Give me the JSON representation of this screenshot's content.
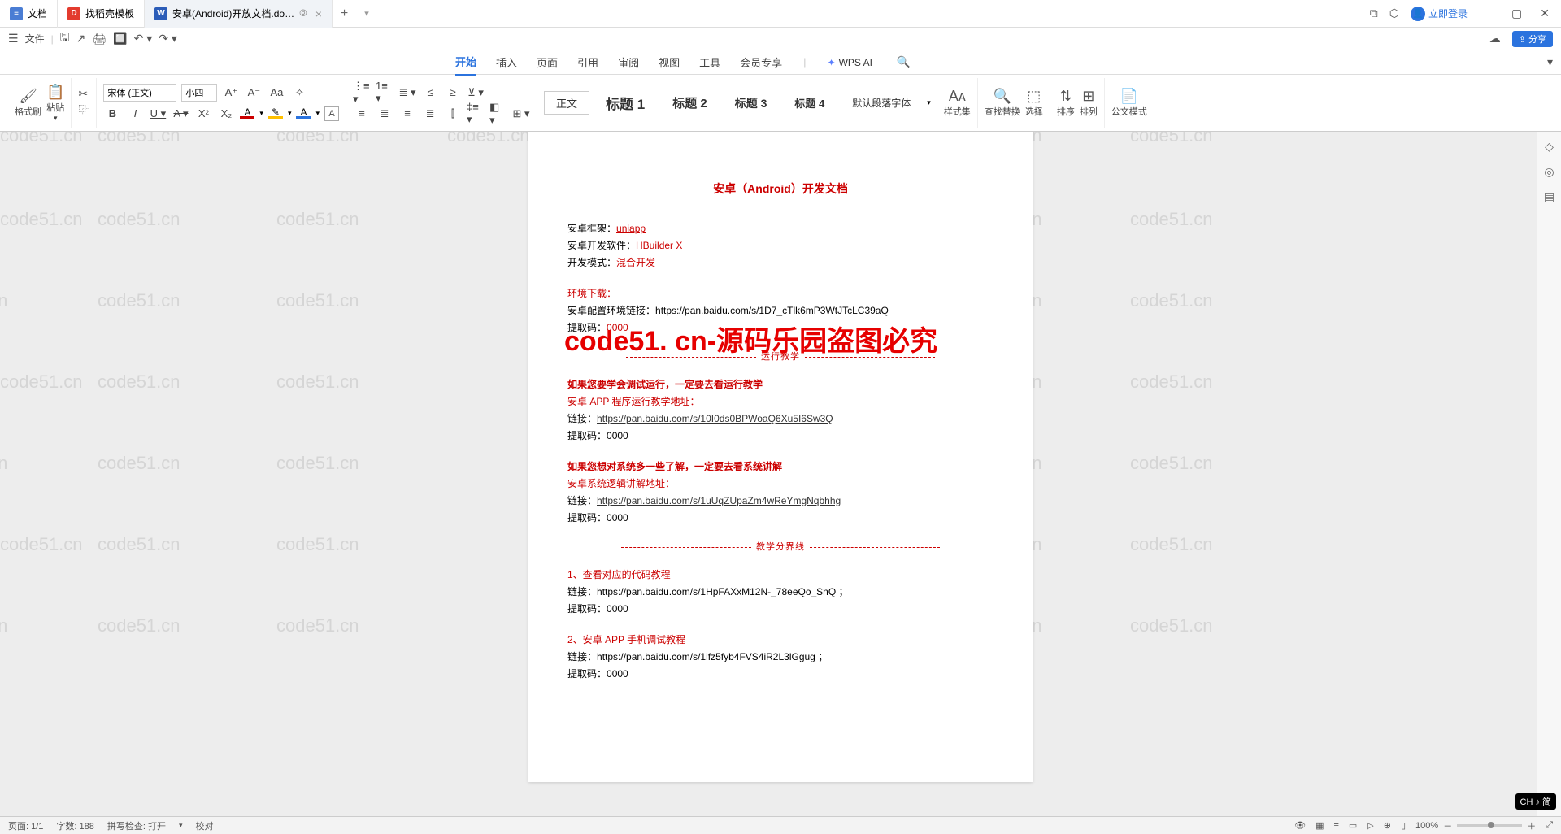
{
  "titlebar": {
    "tabs": [
      {
        "icon_bg": "#4a7dd4",
        "icon_text": "≡",
        "label": "文档"
      },
      {
        "icon_bg": "#e33b2e",
        "icon_text": "D",
        "label": "找稻壳模板"
      },
      {
        "icon_bg": "#2b5cb8",
        "icon_text": "W",
        "label": "安卓(Android)开放文档.do…",
        "active": true,
        "has_close": true
      }
    ],
    "login": "立即登录"
  },
  "quickbar": {
    "file": "文件"
  },
  "menubar": {
    "items": [
      "开始",
      "插入",
      "页面",
      "引用",
      "审阅",
      "视图",
      "工具",
      "会员专享"
    ],
    "active": "开始",
    "wps_ai": "WPS AI"
  },
  "ribbon": {
    "format_painter": "格式刷",
    "paste": "粘贴",
    "font": "宋体 (正文)",
    "size": "小四",
    "styles": {
      "body": "正文",
      "h1": "标题 1",
      "h2": "标题 2",
      "h3": "标题 3",
      "h4": "标题 4",
      "default": "默认段落字体"
    },
    "style_set": "样式集",
    "find": "查找替换",
    "select": "选择",
    "sort": "排序",
    "arrange": "排列",
    "official": "公文模式"
  },
  "document": {
    "title": "安卓（Android）开发文档",
    "line_framework": "安卓框架：",
    "framework": "uniapp",
    "line_software": "安卓开发软件：",
    "software": "HBuilder X",
    "line_mode": "开发模式：",
    "mode": "混合开发",
    "env_download": "环境下载：",
    "env_link_label": "安卓配置环境链接：",
    "env_link": "https://pan.baidu.com/s/1D7_cTlk6mP3WtJTcLC39aQ",
    "code_label": "提取码：",
    "code": "0000",
    "sep_run": "运行教学",
    "run_note": "如果您要学会调试运行，一定要去看运行教学",
    "app_addr_label": "安卓 APP 程序运行教学地址：",
    "link_label": "链接：",
    "run_link": "https://pan.baidu.com/s/10I0ds0BPWoaQ6Xu5I6Sw3Q",
    "sys_note": "如果您想对系统多一些了解，一定要去看系统讲解",
    "sys_addr_label": "安卓系统逻辑讲解地址：",
    "sys_link": "https://pan.baidu.com/s/1uUqZUpaZm4wReYmgNqbhhg",
    "sep_teach": "教学分界线",
    "tut1": "1、查看对应的代码教程",
    "tut1_link": "https://pan.baidu.com/s/1HpFAXxM12N-_78eeQo_SnQ ；",
    "tut2": "2、安卓 APP 手机调试教程",
    "tut2_link": "https://pan.baidu.com/s/1ifz5fyb4FVS4iR2L3lGgug ；",
    "big_watermark": "code51. cn-源码乐园盗图必究"
  },
  "watermark_text": "code51.cn",
  "statusbar": {
    "page": "页面: 1/1",
    "words": "字数: 188",
    "spell": "拼写检查: 打开",
    "proof": "校对",
    "zoom": "100%"
  },
  "ime": "CH ♪ 简"
}
